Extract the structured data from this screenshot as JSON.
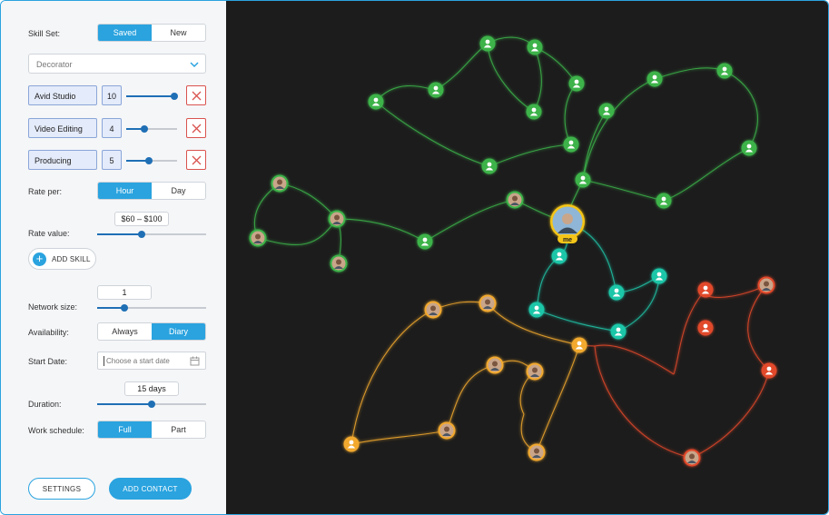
{
  "sidebar": {
    "skill_set": {
      "label": "Skill Set:",
      "options": [
        "Saved",
        "New"
      ],
      "active": 0
    },
    "role_select": {
      "value": "Decorator"
    },
    "skills": [
      {
        "name": "Avid Studio",
        "level": "10",
        "fraction": 1.0
      },
      {
        "name": "Video Editing",
        "level": "4",
        "fraction": 0.35
      },
      {
        "name": "Producing",
        "level": "5",
        "fraction": 0.45
      }
    ],
    "rate_per": {
      "label": "Rate per:",
      "options": [
        "Hour",
        "Day"
      ],
      "active": 0
    },
    "rate_value": {
      "label": "Rate value:",
      "value": "$60 – $100",
      "fraction": 0.4
    },
    "add_skill_label": "ADD SKILL",
    "network_size": {
      "label": "Network size:",
      "value": "1",
      "fraction": 0.25
    },
    "availability": {
      "label": "Availability:",
      "options": [
        "Always",
        "Diary"
      ],
      "active": 1
    },
    "start_date": {
      "label": "Start Date:",
      "placeholder": "Choose a start date"
    },
    "duration": {
      "label": "Duration:",
      "value": "15 days",
      "fraction": 0.5
    },
    "work_schedule": {
      "label": "Work schedule:",
      "options": [
        "Full",
        "Part"
      ],
      "active": 0
    },
    "settings_label": "SETTINGS",
    "add_contact_label": "ADD CONTACT"
  },
  "graph": {
    "me_label": "me",
    "colors": {
      "green": "#3cb34a",
      "teal": "#1ec6a8",
      "orange": "#f2a92f",
      "red": "#e2482b",
      "background": "#1c1c1c"
    }
  }
}
